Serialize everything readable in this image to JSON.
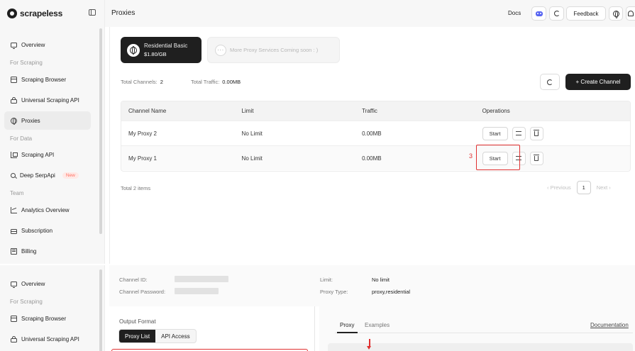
{
  "brand": {
    "name": "scrapeless"
  },
  "sidebar": {
    "items": [
      {
        "label": "Overview",
        "icon": "monitor-icon"
      },
      {
        "label": "Scraping Browser",
        "icon": "browser-icon"
      },
      {
        "label": "Universal Scraping API",
        "icon": "lock-icon"
      },
      {
        "label": "Proxies",
        "icon": "globe-icon"
      },
      {
        "label": "Scraping API",
        "icon": "api-icon"
      },
      {
        "label": "Deep SerpApi",
        "icon": "search-icon",
        "badge": "New"
      },
      {
        "label": "Analytics Overview",
        "icon": "chart-icon"
      },
      {
        "label": "Subscription",
        "icon": "card-icon"
      },
      {
        "label": "Billing",
        "icon": "bill-icon"
      }
    ],
    "sections": [
      "For Scraping",
      "For Data",
      "Team"
    ]
  },
  "header": {
    "title": "Proxies",
    "docs": "Docs",
    "feedback": "Feedback"
  },
  "plans": {
    "active": {
      "name": "Residential Basic",
      "price": "$1.80/GB"
    },
    "more": {
      "dots": "···",
      "text": "More Proxy Services Coming soon : )"
    }
  },
  "stats": {
    "channels_label": "Total Channels:",
    "channels_value": "2",
    "traffic_label": "Total Traffic:",
    "traffic_value": "0.00MB"
  },
  "toolbar": {
    "create_label": "+ Create Channel"
  },
  "table": {
    "headers": [
      "Channel Name",
      "Limit",
      "Traffic",
      "Operations"
    ],
    "rows": [
      {
        "name": "My Proxy 2",
        "limit": "No Limit",
        "traffic": "0.00MB",
        "action": "Start"
      },
      {
        "name": "My Proxy 1",
        "limit": "No Limit",
        "traffic": "0.00MB",
        "action": "Start"
      }
    ]
  },
  "annotation": {
    "step": "3"
  },
  "pagination": {
    "total": "Total 2 items",
    "previous": "‹ Previous",
    "page": "1",
    "next": "Next ›"
  },
  "detail": {
    "channel_id_label": "Channel ID:",
    "channel_password_label": "Channel Password:",
    "limit_label": "Limit:",
    "limit_value": "No limit",
    "proxy_type_label": "Proxy Type:",
    "proxy_type_value": "proxy,residential",
    "output_format_label": "Output Format",
    "format_tabs": [
      "Proxy List",
      "API Access"
    ],
    "code_tabs": [
      "Proxy",
      "Examples"
    ],
    "documentation": "Documentation"
  },
  "colors": {
    "accent": "#1f1f1f",
    "annotation": "#e03030",
    "badge": "#ff6f61"
  }
}
